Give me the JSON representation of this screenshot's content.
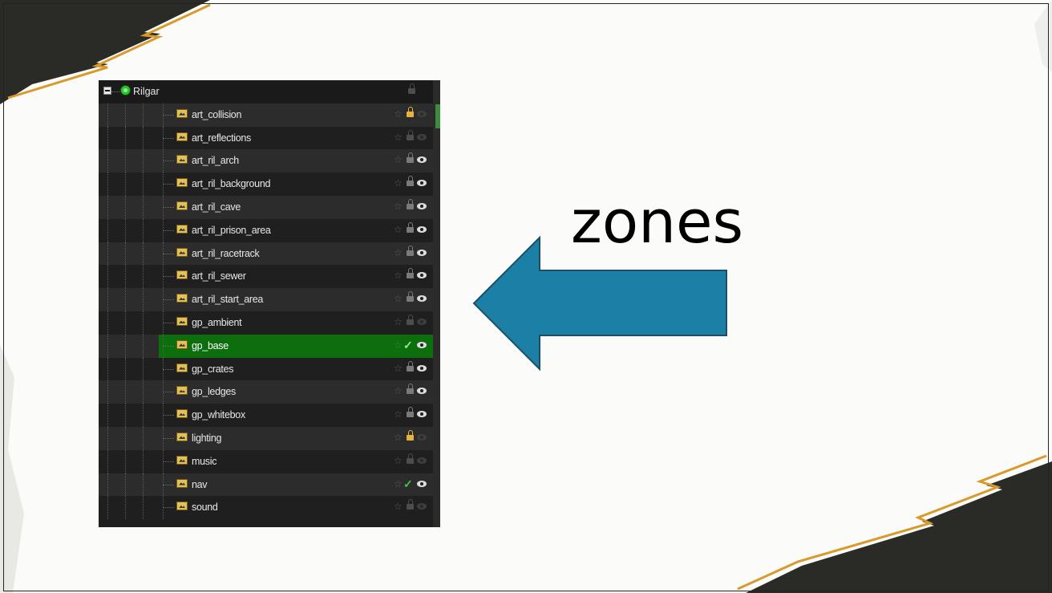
{
  "slide": {
    "callout_text": "zones",
    "accent_color": "#1b7fa6"
  },
  "layers_panel": {
    "root": {
      "label": "Rilgar",
      "icon": "green-circle-icon",
      "expanded": true,
      "locked": false
    },
    "items": [
      {
        "label": "art_collision",
        "visible": false,
        "locked": true,
        "lock_color": "gold",
        "selected": false
      },
      {
        "label": "art_reflections",
        "visible": false,
        "locked": true,
        "lock_color": "dim",
        "selected": false
      },
      {
        "label": "art_ril_arch",
        "visible": true,
        "locked": true,
        "lock_color": "grey",
        "selected": false
      },
      {
        "label": "art_ril_background",
        "visible": true,
        "locked": true,
        "lock_color": "grey",
        "selected": false
      },
      {
        "label": "art_ril_cave",
        "visible": true,
        "locked": true,
        "lock_color": "grey",
        "selected": false
      },
      {
        "label": "art_ril_prison_area",
        "visible": true,
        "locked": true,
        "lock_color": "grey",
        "selected": false
      },
      {
        "label": "art_ril_racetrack",
        "visible": true,
        "locked": true,
        "lock_color": "grey",
        "selected": false
      },
      {
        "label": "art_ril_sewer",
        "visible": true,
        "locked": true,
        "lock_color": "grey",
        "selected": false
      },
      {
        "label": "art_ril_start_area",
        "visible": true,
        "locked": true,
        "lock_color": "grey",
        "selected": false
      },
      {
        "label": "gp_ambient",
        "visible": false,
        "locked": true,
        "lock_color": "dim",
        "selected": false
      },
      {
        "label": "gp_base",
        "visible": true,
        "locked": false,
        "checked": true,
        "selected": true
      },
      {
        "label": "gp_crates",
        "visible": true,
        "locked": true,
        "lock_color": "grey",
        "selected": false
      },
      {
        "label": "gp_ledges",
        "visible": true,
        "locked": true,
        "lock_color": "grey",
        "selected": false
      },
      {
        "label": "gp_whitebox",
        "visible": true,
        "locked": true,
        "lock_color": "grey",
        "selected": false
      },
      {
        "label": "lighting",
        "visible": false,
        "locked": true,
        "lock_color": "gold",
        "selected": false
      },
      {
        "label": "music",
        "visible": false,
        "locked": true,
        "lock_color": "dim",
        "selected": false
      },
      {
        "label": "nav",
        "visible": true,
        "locked": false,
        "checked": true,
        "selected": false
      },
      {
        "label": "sound",
        "visible": false,
        "locked": true,
        "lock_color": "dim",
        "selected": false
      }
    ]
  }
}
